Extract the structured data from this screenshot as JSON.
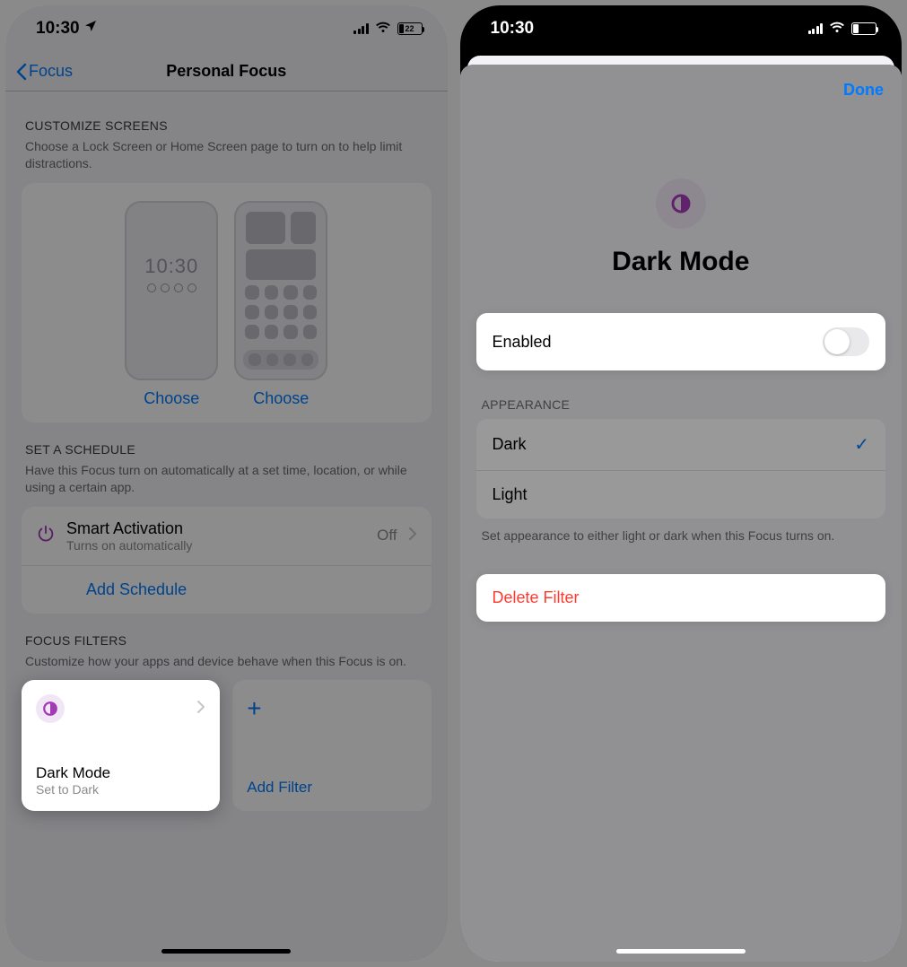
{
  "status": {
    "time": "10:30",
    "battery": "22"
  },
  "left": {
    "nav": {
      "back": "Focus",
      "title": "Personal Focus"
    },
    "customize": {
      "header": "Customize Screens",
      "desc": "Choose a Lock Screen or Home Screen page to turn on to help limit distractions.",
      "lock_time": "10:30",
      "choose": "Choose"
    },
    "schedule": {
      "header": "Set a Schedule",
      "desc": "Have this Focus turn on automatically at a set time, location, or while using a certain app.",
      "smart_title": "Smart Activation",
      "smart_sub": "Turns on automatically",
      "smart_val": "Off",
      "add": "Add Schedule"
    },
    "filters": {
      "header": "Focus Filters",
      "desc": "Customize how your apps and device behave when this Focus is on.",
      "dm_title": "Dark Mode",
      "dm_sub": "Set to Dark",
      "add_filter": "Add Filter"
    }
  },
  "right": {
    "done": "Done",
    "title": "Dark Mode",
    "enabled_label": "Enabled",
    "appearance_header": "Appearance",
    "dark": "Dark",
    "light": "Light",
    "footer": "Set appearance to either light or dark when this Focus turns on.",
    "delete": "Delete Filter"
  }
}
